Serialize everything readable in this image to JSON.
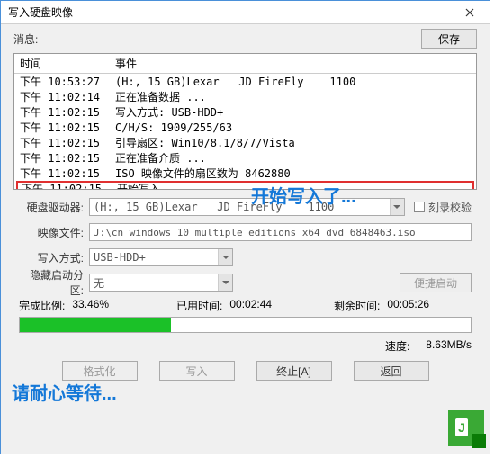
{
  "window": {
    "title": "写入硬盘映像"
  },
  "toolbar": {
    "info_label": "消息:",
    "save_label": "保存"
  },
  "log": {
    "header_time": "时间",
    "header_event": "事件",
    "rows": [
      {
        "time": "下午 10:53:27",
        "event": "(H:, 15 GB)Lexar   JD FireFly    1100"
      },
      {
        "time": "下午 11:02:14",
        "event": "正在准备数据 ..."
      },
      {
        "time": "下午 11:02:15",
        "event": "写入方式: USB-HDD+"
      },
      {
        "time": "下午 11:02:15",
        "event": "C/H/S: 1909/255/63"
      },
      {
        "time": "下午 11:02:15",
        "event": "引导扇区: Win10/8.1/8/7/Vista"
      },
      {
        "time": "下午 11:02:15",
        "event": "正在准备介质 ..."
      },
      {
        "time": "下午 11:02:15",
        "event": "ISO 映像文件的扇区数为 8462880"
      },
      {
        "time": "下午 11:02:15",
        "event": "开始写入 ..."
      }
    ]
  },
  "annotations": {
    "start_write": "开始写入了...",
    "please_wait": "请耐心等待..."
  },
  "form": {
    "drive_label": "硬盘驱动器:",
    "drive_value": "(H:, 15 GB)Lexar   JD FireFly    1100",
    "verify_label": "刻录校验",
    "image_label": "映像文件:",
    "image_value": "J:\\cn_windows_10_multiple_editions_x64_dvd_6848463.iso",
    "method_label": "写入方式:",
    "method_value": "USB-HDD+",
    "hidden_label": "隐藏启动分区:",
    "hidden_value": "无",
    "portable_btn": "便捷启动"
  },
  "progress": {
    "completed_label": "完成比例:",
    "completed_value": "33.46%",
    "elapsed_label": "已用时间:",
    "elapsed_value": "00:02:44",
    "remain_label": "剩余时间:",
    "remain_value": "00:05:26",
    "fill_pct": 33.46
  },
  "speed": {
    "label": "速度:",
    "value": "8.63MB/s"
  },
  "buttons": {
    "format": "格式化",
    "write": "写入",
    "abort": "终止[A]",
    "back": "返回"
  }
}
